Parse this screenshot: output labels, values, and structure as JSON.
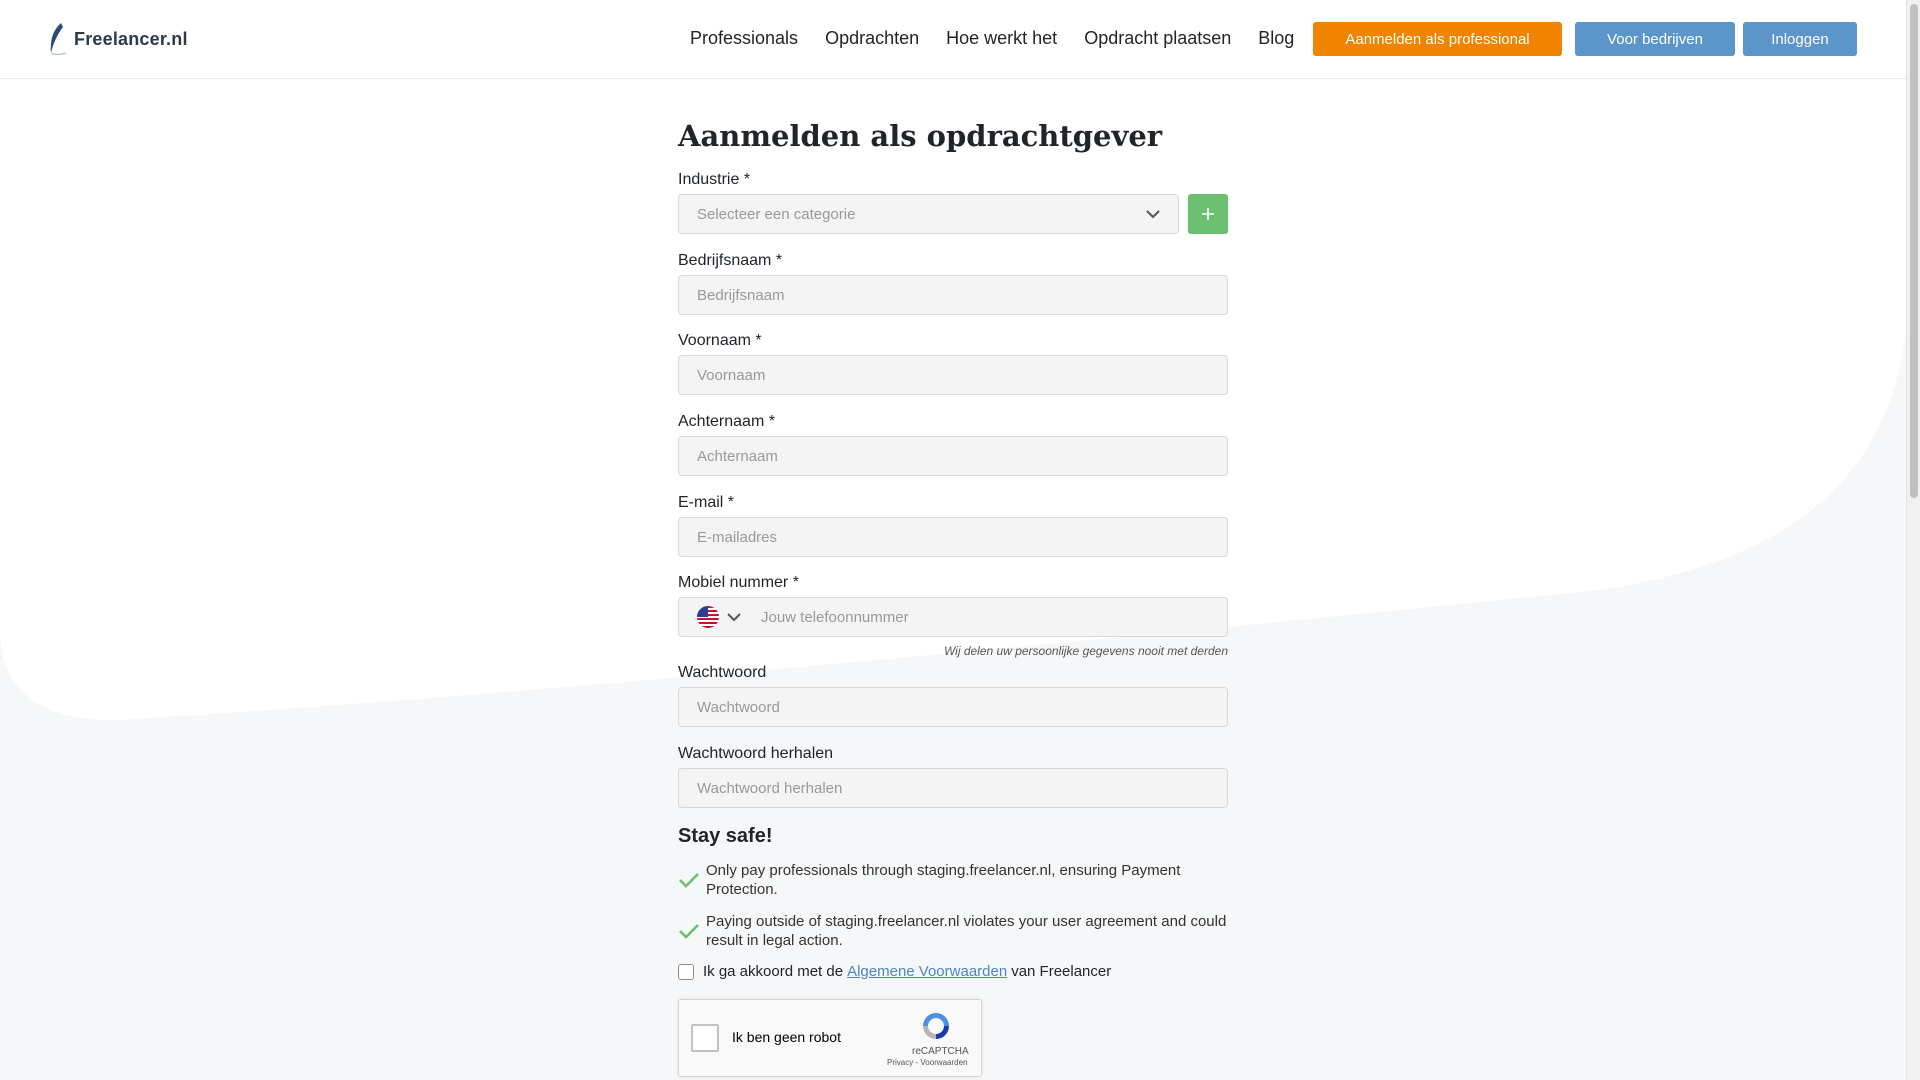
{
  "header": {
    "logo_text": "Freelancer.nl",
    "nav": [
      "Professionals",
      "Opdrachten",
      "Hoe werkt het",
      "Opdracht plaatsen",
      "Blog"
    ],
    "register_professional_label": "Aanmelden als professional",
    "for_companies_label": "Voor bedrijven",
    "login_label": "Inloggen"
  },
  "form": {
    "title": "Aanmelden als opdrachtgever",
    "industry": {
      "label": "Industrie *",
      "placeholder": "Selecteer een categorie"
    },
    "company": {
      "label": "Bedrijfsnaam *",
      "placeholder": "Bedrijfsnaam"
    },
    "first_name": {
      "label": "Voornaam *",
      "placeholder": "Voornaam"
    },
    "last_name": {
      "label": "Achternaam *",
      "placeholder": "Achternaam"
    },
    "email": {
      "label": "E-mail *",
      "placeholder": "E-mailadres"
    },
    "phone": {
      "label": "Mobiel nummer *",
      "placeholder": "Jouw telefoonnummer",
      "country_flag": "us-flag-icon"
    },
    "privacy_note": "Wij delen uw persoonlijke gegevens nooit met derden",
    "password": {
      "label": "Wachtwoord",
      "placeholder": "Wachtwoord"
    },
    "password_repeat": {
      "label": "Wachtwoord herhalen",
      "placeholder": "Wachtwoord herhalen"
    },
    "safety_title": "Stay safe!",
    "safety_points": [
      "Only pay professionals through staging.freelancer.nl, ensuring Payment Protection.",
      "Paying outside of staging.freelancer.nl violates your user agreement and could result in legal action."
    ],
    "terms_prefix": "Ik ga akkoord met de",
    "terms_link": "Algemene Voorwaarden",
    "terms_suffix": "van Freelancer",
    "captcha_label": "Ik ben geen robot",
    "captcha_brand": "reCAPTCHA",
    "captcha_links": "Privacy - Voorwaarden"
  },
  "colors": {
    "accent_orange": "#f08300",
    "accent_blue": "#5b95c9",
    "accent_green": "#6cc070",
    "link_blue": "#4a86c6"
  }
}
